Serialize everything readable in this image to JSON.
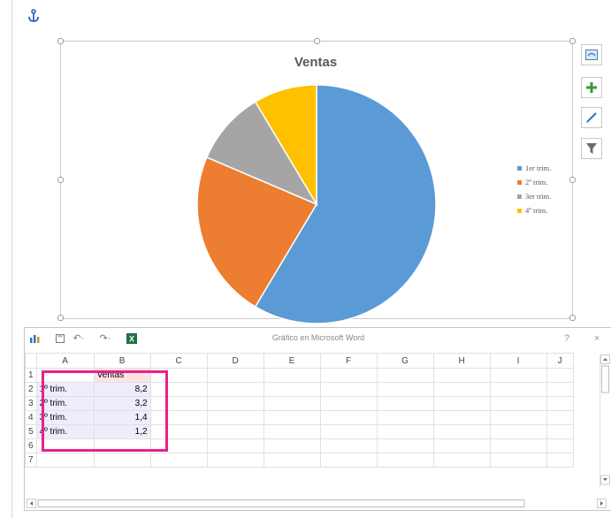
{
  "chart": {
    "title": "Ventas",
    "legend": [
      {
        "label": "1er trim.",
        "color": "#5b9bd5"
      },
      {
        "label": "2º trim.",
        "color": "#ed7d31"
      },
      {
        "label": "3er trim.",
        "color": "#a5a5a5"
      },
      {
        "label": "4º trim.",
        "color": "#ffc000"
      }
    ],
    "side_buttons": [
      "layout-options-icon",
      "plus-icon",
      "paintbrush-icon",
      "filter-icon"
    ]
  },
  "chart_data": {
    "type": "pie",
    "title": "Ventas",
    "categories": [
      "1er trim.",
      "2º trim.",
      "3er trim.",
      "4º trim."
    ],
    "values": [
      8.2,
      3.2,
      1.4,
      1.2
    ],
    "colors": [
      "#5b9bd5",
      "#ed7d31",
      "#a5a5a5",
      "#ffc000"
    ],
    "legend_position": "right"
  },
  "sheet": {
    "window_title": "Gráfico en Microsoft Word",
    "help": "?",
    "close": "×",
    "col_headers": [
      "",
      "A",
      "B",
      "C",
      "D",
      "E",
      "F",
      "G",
      "H",
      "I",
      "J"
    ],
    "rows": [
      {
        "n": "1",
        "a": "",
        "b": "Ventas"
      },
      {
        "n": "2",
        "a": "1º trim.",
        "b": "8,2"
      },
      {
        "n": "3",
        "a": "2º trim.",
        "b": "3,2"
      },
      {
        "n": "4",
        "a": "3º trim.",
        "b": "1,4"
      },
      {
        "n": "5",
        "a": "4º trim.",
        "b": "1,2"
      },
      {
        "n": "6",
        "a": "",
        "b": ""
      },
      {
        "n": "7",
        "a": "",
        "b": ""
      }
    ]
  }
}
